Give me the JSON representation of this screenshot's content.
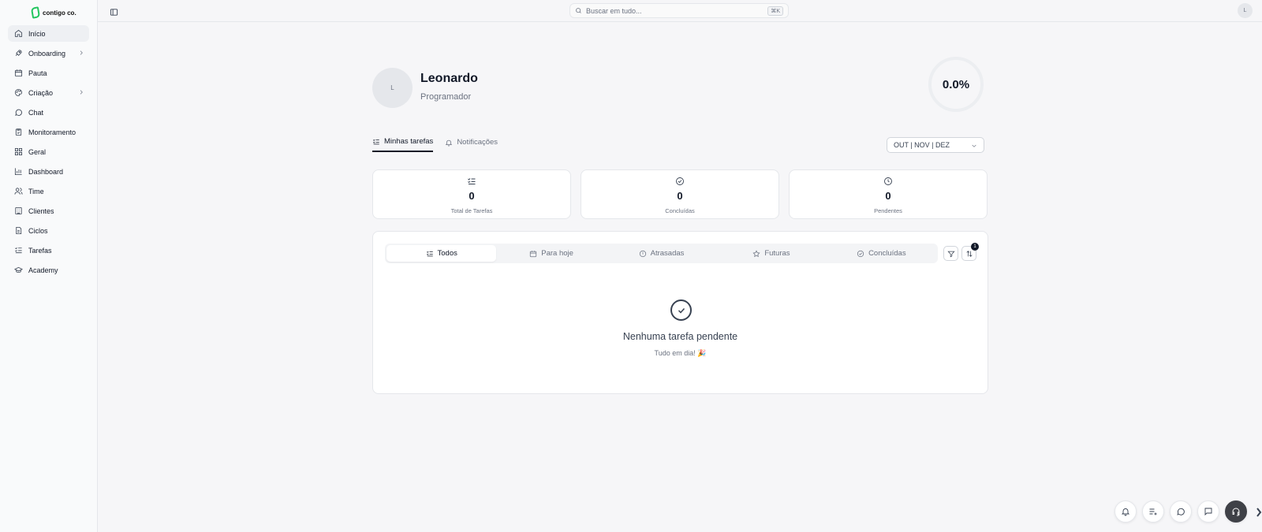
{
  "brand": {
    "logo_text": "contigo co."
  },
  "sidebar": {
    "items": [
      {
        "label": "Início",
        "icon": "home-icon",
        "active": true
      },
      {
        "label": "Onboarding",
        "icon": "rocket-icon",
        "chevron": true
      },
      {
        "label": "Pauta",
        "icon": "calendar-icon"
      },
      {
        "label": "Criação",
        "icon": "palette-icon",
        "chevron": true
      },
      {
        "label": "Chat",
        "icon": "chat-icon"
      },
      {
        "label": "Monitoramento",
        "icon": "clipboard-icon"
      },
      {
        "label": "Geral",
        "icon": "grid-icon"
      },
      {
        "label": "Dashboard",
        "icon": "bar-chart-icon"
      },
      {
        "label": "Time",
        "icon": "users-icon"
      },
      {
        "label": "Clientes",
        "icon": "building-icon"
      },
      {
        "label": "Ciclos",
        "icon": "document-icon"
      },
      {
        "label": "Tarefas",
        "icon": "task-list-icon"
      },
      {
        "label": "Academy",
        "icon": "graduation-cap-icon"
      }
    ]
  },
  "topbar": {
    "search_placeholder": "Buscar em tudo...",
    "shortcut": "⌘K",
    "avatar_initial": "L"
  },
  "profile": {
    "avatar_initial": "L",
    "name": "Leonardo",
    "role": "Programador",
    "completion": "0.0%"
  },
  "tabs": [
    {
      "label": "Minhas tarefas",
      "active": true
    },
    {
      "label": "Notificações"
    }
  ],
  "period_select": {
    "value": "OUT | NOV | DEZ"
  },
  "stats": [
    {
      "value": "0",
      "label": "Total de Tarefas",
      "icon": "task-list-icon"
    },
    {
      "value": "0",
      "label": "Concluídas",
      "icon": "check-circle-icon"
    },
    {
      "value": "0",
      "label": "Pendentes",
      "icon": "clock-icon"
    }
  ],
  "task_filters": [
    {
      "label": "Todos",
      "active": true
    },
    {
      "label": "Para hoje"
    },
    {
      "label": "Atrasadas"
    },
    {
      "label": "Futuras"
    },
    {
      "label": "Concluídas"
    }
  ],
  "sort_badge": "1",
  "empty_state": {
    "title": "Nenhuma tarefa pendente",
    "subtitle": "Tudo em dia! 🎉"
  },
  "colors": {
    "accent_dark": "#111827",
    "brand_green": "#22c55e"
  }
}
